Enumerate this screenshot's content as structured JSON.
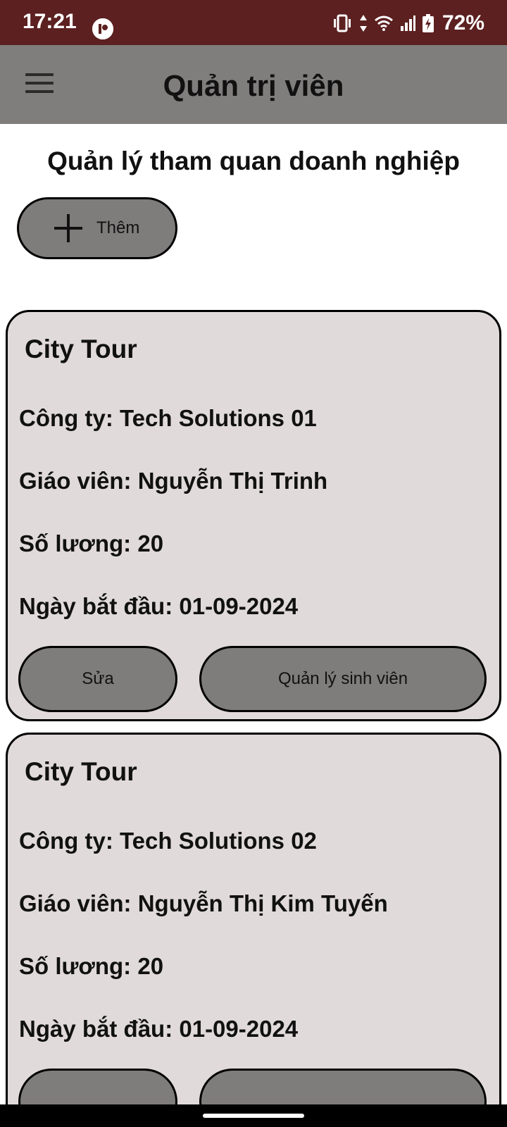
{
  "status_bar": {
    "time": "17:21",
    "battery": "72%",
    "background": "#5c2020"
  },
  "app_bar": {
    "title": "Quản trị viên",
    "menu_icon": "hamburger-menu-icon",
    "background": "#807d7d"
  },
  "page": {
    "heading": "Quản lý tham quan doanh nghiệp",
    "add_button": {
      "label": "Thêm",
      "icon": "plus-icon"
    }
  },
  "tours": [
    {
      "title": "City Tour",
      "company": "Công ty: Tech Solutions 01",
      "teacher": "Giáo viên: Nguyễn Thị Trinh",
      "quantity": "Số lương: 20",
      "start_date": "Ngày bắt đầu: 01-09-2024",
      "edit_label": "Sửa",
      "manage_label": "Quản lý sinh viên"
    },
    {
      "title": "City Tour",
      "company": "Công ty: Tech Solutions 02",
      "teacher": "Giáo viên: Nguyễn Thị Kim Tuyến",
      "quantity": "Số lương: 20",
      "start_date": "Ngày bắt đầu: 01-09-2024",
      "edit_label": "",
      "manage_label": ""
    }
  ],
  "colors": {
    "card_background": "#e1dada",
    "button_background": "#7f7c7c"
  }
}
